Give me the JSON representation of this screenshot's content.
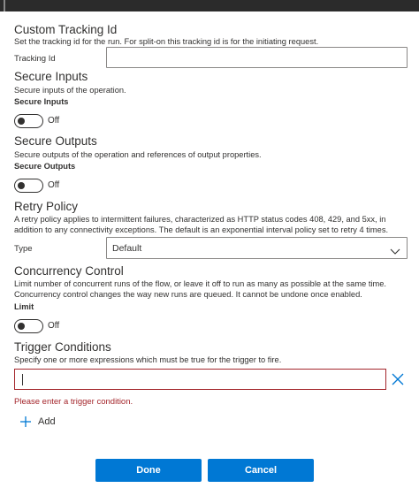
{
  "custom_tracking": {
    "heading": "Custom Tracking Id",
    "description": "Set the tracking id for the run. For split-on this tracking id is for the initiating request.",
    "field_label": "Tracking Id",
    "value": ""
  },
  "secure_inputs": {
    "heading": "Secure Inputs",
    "description": "Secure inputs of the operation.",
    "label": "Secure Inputs",
    "toggle_state": "Off"
  },
  "secure_outputs": {
    "heading": "Secure Outputs",
    "description": "Secure outputs of the operation and references of output properties.",
    "label": "Secure Outputs",
    "toggle_state": "Off"
  },
  "retry_policy": {
    "heading": "Retry Policy",
    "description": "A retry policy applies to intermittent failures, characterized as HTTP status codes 408, 429, and 5xx, in addition to any connectivity exceptions. The default is an exponential interval policy set to retry 4 times.",
    "type_label": "Type",
    "type_value": "Default"
  },
  "concurrency": {
    "heading": "Concurrency Control",
    "description": "Limit number of concurrent runs of the flow, or leave it off to run as many as possible at the same time. Concurrency control changes the way new runs are queued. It cannot be undone once enabled.",
    "label": "Limit",
    "toggle_state": "Off"
  },
  "trigger_conditions": {
    "heading": "Trigger Conditions",
    "description": "Specify one or more expressions which must be true for the trigger to fire.",
    "value": "",
    "error": "Please enter a trigger condition.",
    "add_label": "Add"
  },
  "footer": {
    "done_label": "Done",
    "cancel_label": "Cancel"
  },
  "colors": {
    "accent": "#0078d4",
    "error": "#a4262c",
    "icon_blue": "#0078d4"
  },
  "icons": {
    "chevron": "chevron-down-icon",
    "clear": "close-icon",
    "add": "plus-icon"
  }
}
